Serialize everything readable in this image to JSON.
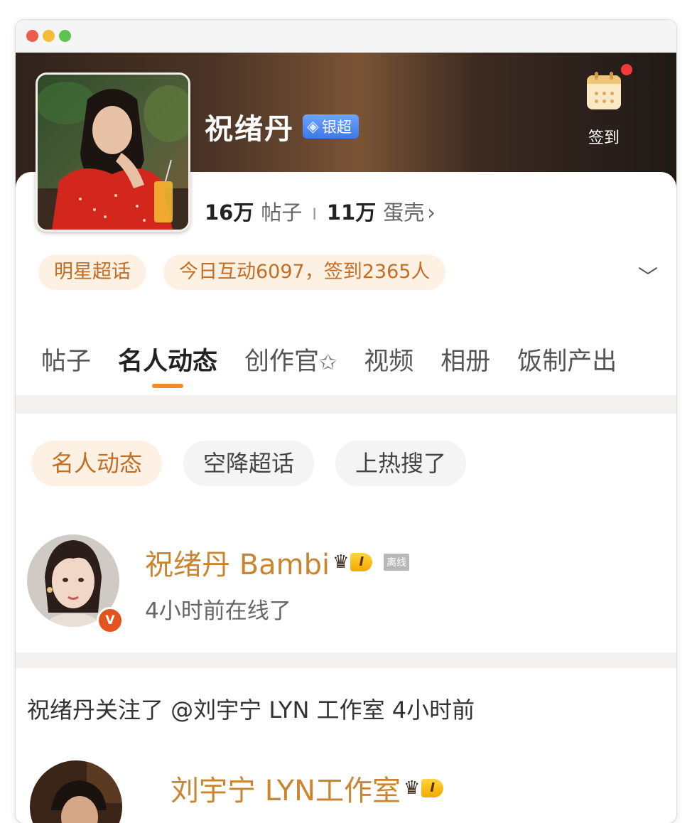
{
  "window": {
    "controls": [
      "close",
      "minimize",
      "zoom"
    ]
  },
  "header": {
    "name": "祝绪丹",
    "badge": "银超",
    "checkin_label": "签到"
  },
  "stats": {
    "posts_num": "16万",
    "posts_unit": "帖子",
    "separator": "I",
    "eggs_num": "11万",
    "eggs_unit": "蛋壳",
    "chevron": "›"
  },
  "chips": {
    "category": "明星超话",
    "today": "今日互动6097，签到2365人"
  },
  "tabs": [
    "帖子",
    "名人动态",
    "创作官",
    "视频",
    "相册",
    "饭制产出"
  ],
  "filters": [
    "名人动态",
    "空降超话",
    "上热搜了"
  ],
  "user": {
    "name": "祝绪丹 Bambi",
    "level": "I",
    "offline": "离线",
    "status": "4小时前在线了",
    "verify": "V"
  },
  "activity": "祝绪丹关注了 @刘宇宁 LYN 工作室 4小时前",
  "user2": {
    "name": "刘宇宁 LYN工作室",
    "level": "I"
  },
  "colors": {
    "accent": "#c66d24",
    "tab_indicator": "#f28b2a",
    "name_gold": "#c9862f"
  }
}
